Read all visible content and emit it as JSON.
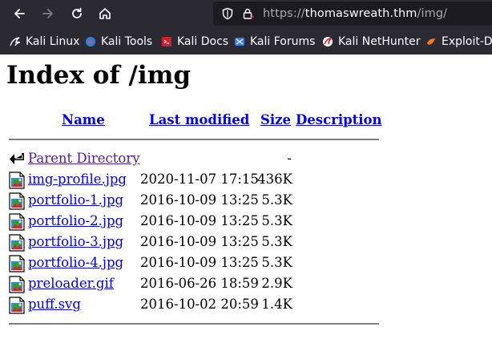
{
  "browser": {
    "url": {
      "scheme": "https://",
      "host": "thomaswreath.thm",
      "path": "/img/"
    },
    "bookmarks": [
      {
        "label": "Kali Linux",
        "icon": "kali-dragon-icon"
      },
      {
        "label": "Kali Tools",
        "icon": "kali-tools-icon"
      },
      {
        "label": "Kali Docs",
        "icon": "kali-docs-icon"
      },
      {
        "label": "Kali Forums",
        "icon": "kali-forums-icon"
      },
      {
        "label": "Kali NetHunter",
        "icon": "kali-nethunter-icon"
      },
      {
        "label": "Exploit-D",
        "icon": "exploit-db-icon"
      }
    ],
    "colors": {
      "chrome": "#2b2a33",
      "urlbar": "#1c1b22"
    }
  },
  "page": {
    "title": "Index of /img",
    "columns": {
      "name": "Name",
      "modified": "Last modified",
      "size": "Size",
      "description": "Description"
    },
    "parent": {
      "label": "Parent Directory",
      "size": "-",
      "icon": "back-arrow-icon"
    },
    "files": [
      {
        "name": "img-profile.jpg",
        "modified": "2020-11-07 17:15",
        "size": "436K",
        "icon": "image-file-icon"
      },
      {
        "name": "portfolio-1.jpg",
        "modified": "2016-10-09 13:25",
        "size": "5.3K",
        "icon": "image-file-icon"
      },
      {
        "name": "portfolio-2.jpg",
        "modified": "2016-10-09 13:25",
        "size": "5.3K",
        "icon": "image-file-icon"
      },
      {
        "name": "portfolio-3.jpg",
        "modified": "2016-10-09 13:25",
        "size": "5.3K",
        "icon": "image-file-icon"
      },
      {
        "name": "portfolio-4.jpg",
        "modified": "2016-10-09 13:25",
        "size": "5.3K",
        "icon": "image-file-icon"
      },
      {
        "name": "preloader.gif",
        "modified": "2016-06-26 18:59",
        "size": "2.9K",
        "icon": "image-file-icon"
      },
      {
        "name": "puff.svg",
        "modified": "2016-10-02 20:59",
        "size": "1.4K",
        "icon": "image-file-icon"
      }
    ]
  }
}
